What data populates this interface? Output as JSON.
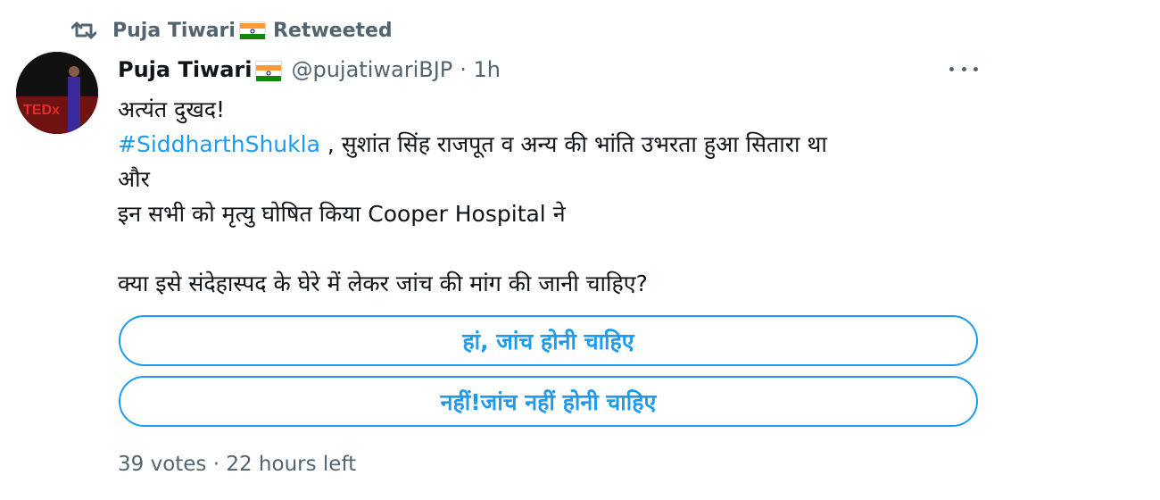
{
  "retweet": {
    "icon": "retweet-icon",
    "label": "Puja Tiwari",
    "suffix": "Retweeted"
  },
  "tweet": {
    "author_name": "Puja Tiwari",
    "handle": "@pujatiwariBJP",
    "time": "· 1h",
    "avatar_text": "TEDx",
    "more_icon": "more-icon",
    "lines": [
      "अत्यंत दुखद!",
      "#SiddharthShukla",
      " , सुशांत सिंह राजपूत व अन्य की भांति उभरता हुआ सितारा था",
      "और",
      "इन सभी को मृत्यु घोषित किया Cooper Hospital ने",
      "क्या इसे संदेहास्पद के घेरे में लेकर जांच की मांग की जानी चाहिए?"
    ]
  },
  "poll": {
    "options": [
      "हां, जांच होनी चाहिए",
      "नहीं!जांच नहीं होनी चाहिए"
    ],
    "votes": "39 votes",
    "time_left": "22 hours left"
  },
  "colors": {
    "accent": "#1d9bf0",
    "muted": "#536471",
    "text": "#0f1419"
  }
}
